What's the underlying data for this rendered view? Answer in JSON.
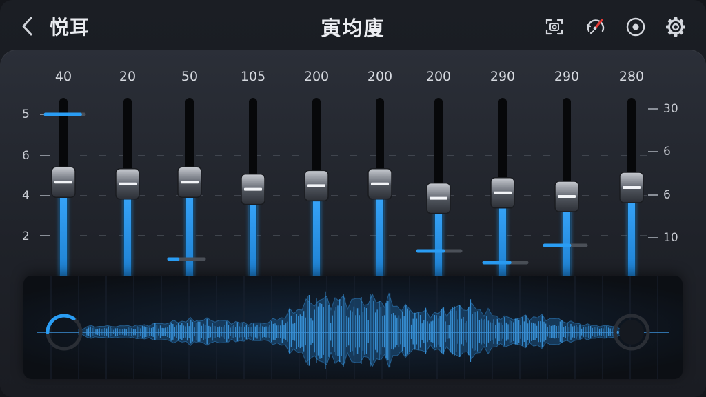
{
  "header": {
    "app_title": "悦耳",
    "page_title": "寅均廋"
  },
  "icons": {
    "back": "chevron-left-icon",
    "capture": "screen-capture-icon",
    "gauge": "gauge-icon",
    "record": "record-icon",
    "settings": "gear-icon"
  },
  "colors": {
    "accent": "#2a9df4",
    "accent_glow": "#4db8ff",
    "gauge_needle": "#e53935",
    "text": "#e6e8ec"
  },
  "left_scale": [
    "5",
    "6",
    "4",
    "2"
  ],
  "right_scale": [
    "30",
    "6",
    "6",
    "10"
  ],
  "bands": [
    {
      "value": "40",
      "level": 0.53
    },
    {
      "value": "20",
      "level": 0.52
    },
    {
      "value": "50",
      "level": 0.53
    },
    {
      "value": "105",
      "level": 0.49
    },
    {
      "value": "200",
      "level": 0.51
    },
    {
      "value": "200",
      "level": 0.52
    },
    {
      "value": "200",
      "level": 0.44
    },
    {
      "value": "290",
      "level": 0.47
    },
    {
      "value": "290",
      "level": 0.45
    },
    {
      "value": "280",
      "level": 0.5
    }
  ],
  "waveform": {
    "left_dial_level": 0.35,
    "right_dial_level": 0.0
  }
}
